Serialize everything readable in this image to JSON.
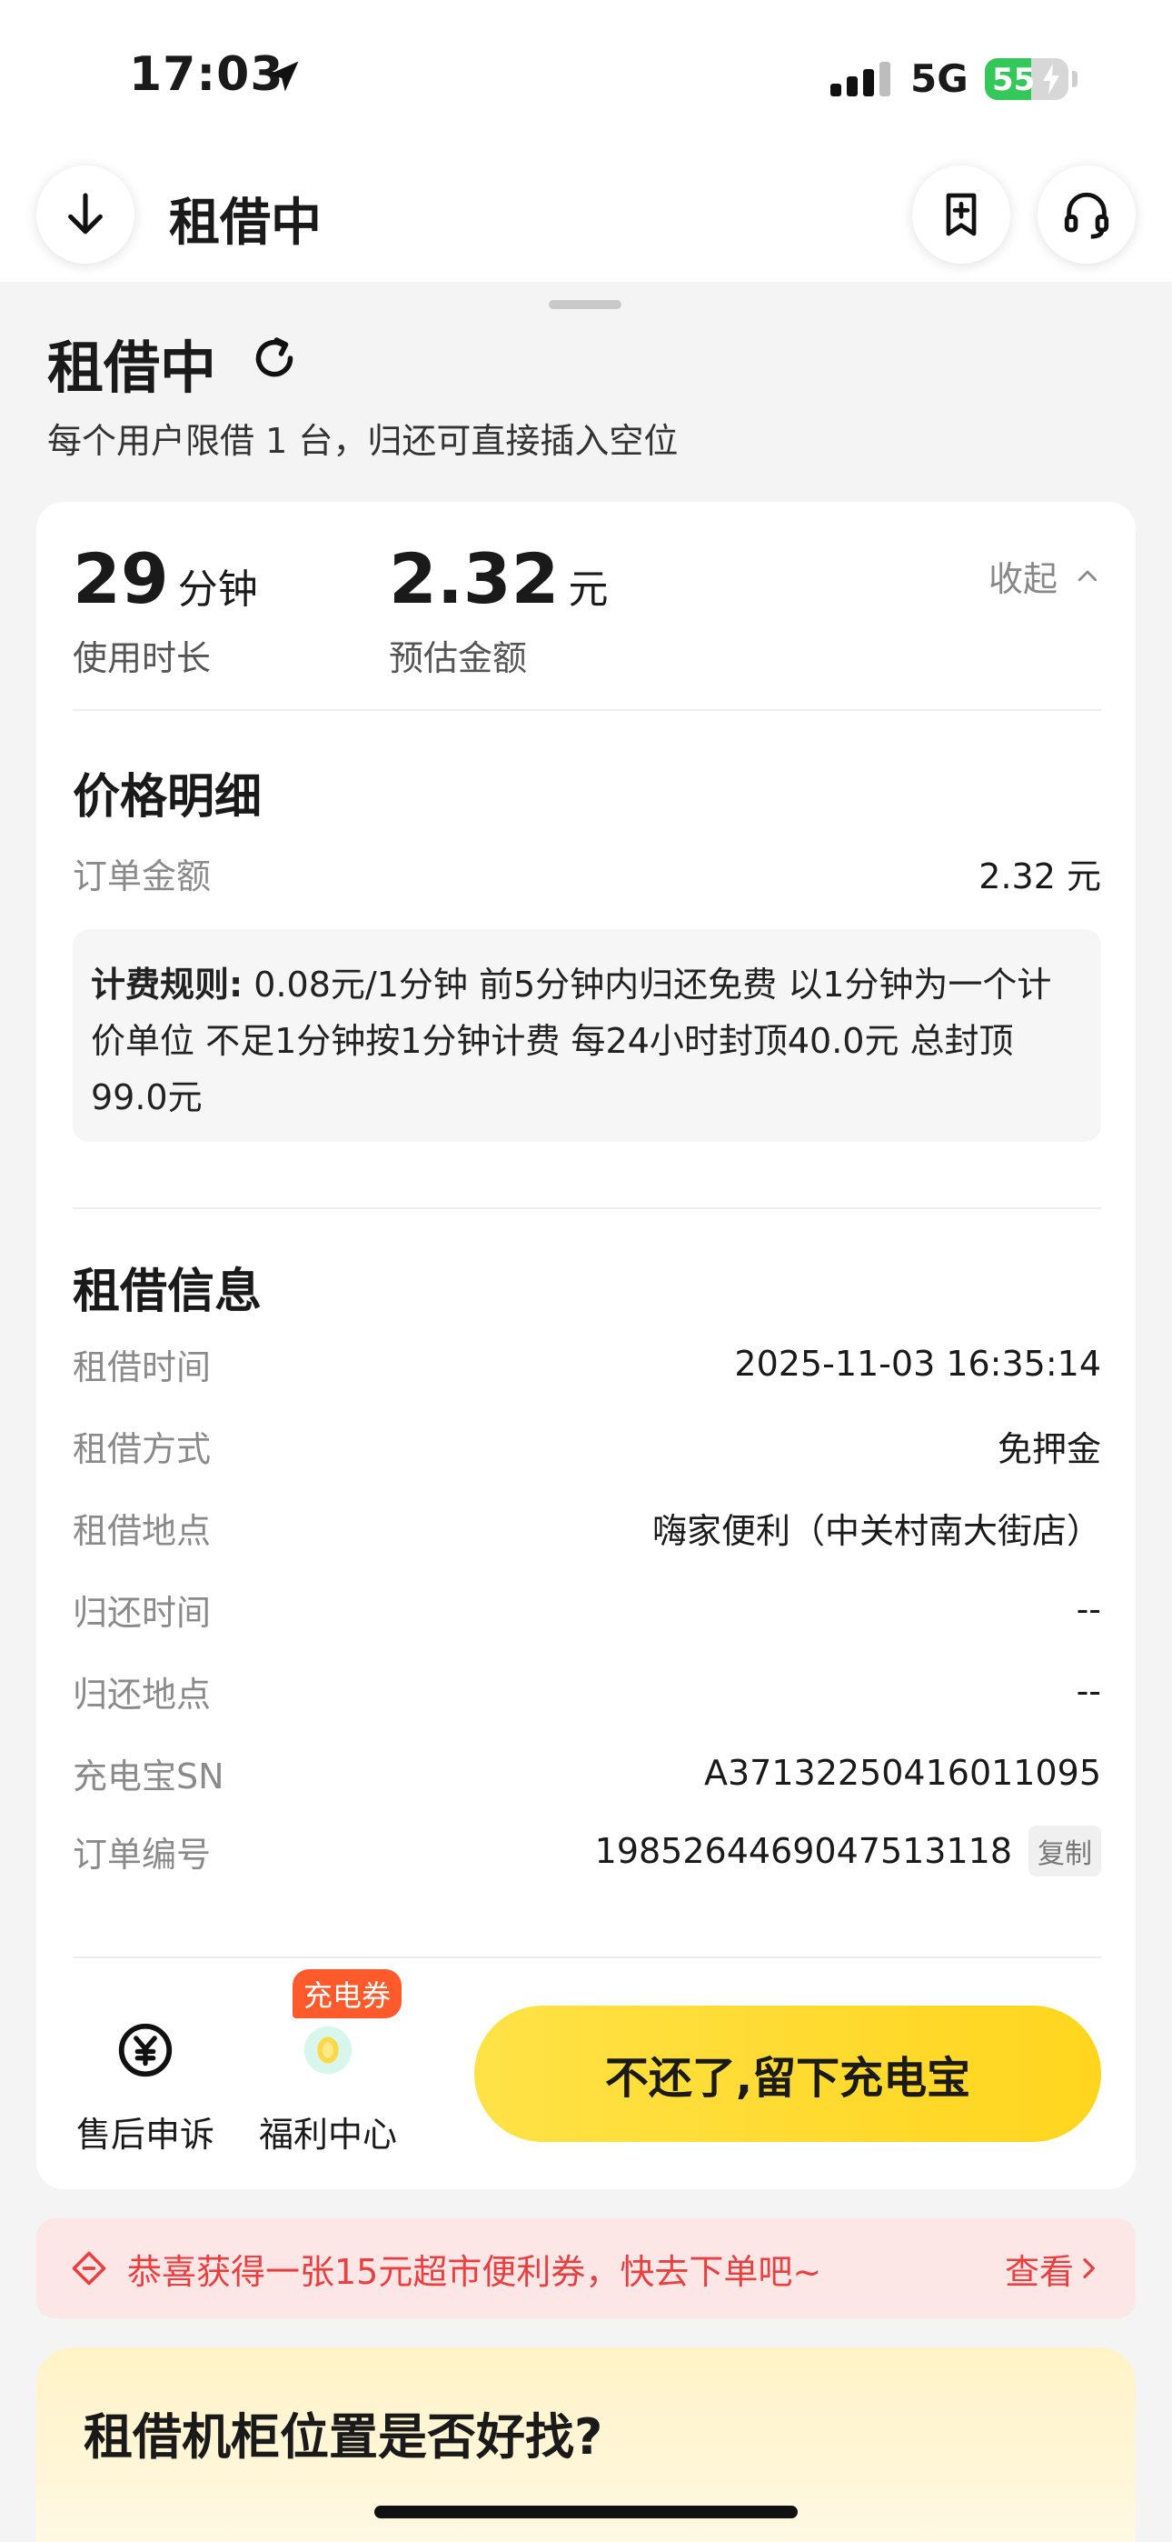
{
  "status_bar": {
    "time": "17:03",
    "network": "5G",
    "battery": "55",
    "battery_level": 0.55
  },
  "header": {
    "title": "租借中",
    "back_icon": "arrow-down-icon",
    "add_icon": "bookmark-plus-icon",
    "service_icon": "headset-icon"
  },
  "sheet": {
    "title": "租借中",
    "subtitle": "每个用户限借 1 台，归还可直接插入空位"
  },
  "summary": {
    "duration_value": "29",
    "duration_unit": "分钟",
    "duration_label": "使用时长",
    "amount_value": "2.32",
    "amount_unit": "元",
    "amount_label": "预估金额",
    "collapse_label": "收起"
  },
  "price_detail": {
    "title": "价格明细",
    "order_amount_label": "订单金额",
    "order_amount_value": "2.32 元",
    "rule_label": "计费规则:",
    "rule_text": "0.08元/1分钟 前5分钟内归还免费 以1分钟为一个计价单位 不足1分钟按1分钟计费 每24小时封顶40.0元 总封顶99.0元"
  },
  "rental_info": {
    "title": "租借信息",
    "rows": [
      {
        "label": "租借时间",
        "value": "2025-11-03 16:35:14"
      },
      {
        "label": "租借方式",
        "value": "免押金"
      },
      {
        "label": "租借地点",
        "value": "嗨家便利（中关村南大街店）"
      },
      {
        "label": "归还时间",
        "value": "--"
      },
      {
        "label": "归还地点",
        "value": "--"
      },
      {
        "label": "充电宝SN",
        "value": "A37132250416011095"
      }
    ],
    "order_no_label": "订单编号",
    "order_no_value": "1985264469047513118",
    "copy_label": "复制"
  },
  "actions": {
    "after_sales_label": "售后申诉",
    "welfare_label": "福利中心",
    "coupon_badge": "充电券",
    "primary_label": "不还了,留下充电宝"
  },
  "banner": {
    "text": "恭喜获得一张15元超市便利券，快去下单吧~",
    "link": "查看"
  },
  "survey": {
    "title": "租借机柜位置是否好找?"
  },
  "colors": {
    "accent_yellow": "#ffd51e",
    "banner_red": "#e84040",
    "battery_green": "#34c759",
    "badge_orange": "#ff5a2c"
  }
}
